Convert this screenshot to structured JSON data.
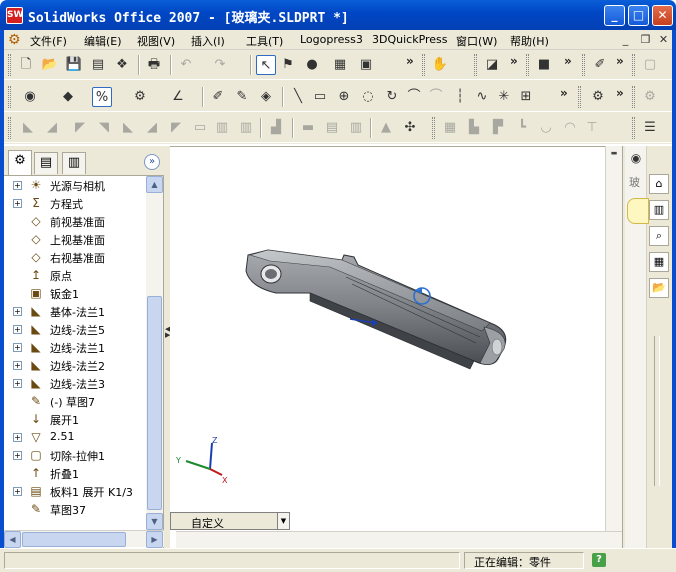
{
  "window": {
    "title": "SolidWorks Office 2007 - [玻璃夹.SLDPRT *]",
    "app_icon": "SW",
    "minimize": "_",
    "maximize": "□",
    "close": "✕"
  },
  "menu": {
    "items": [
      {
        "label": "文件",
        "key": "(F)"
      },
      {
        "label": "编辑",
        "key": "(E)"
      },
      {
        "label": "视图",
        "key": "(V)"
      },
      {
        "label": "插入",
        "key": "(I)"
      },
      {
        "label": "工具",
        "key": "(T)"
      },
      {
        "label": "Logopress3",
        "key": ""
      },
      {
        "label": "3DQuickPress",
        "key": ""
      },
      {
        "label": "窗口",
        "key": "(W)"
      },
      {
        "label": "帮助",
        "key": "(H)"
      }
    ],
    "mdi_minimize": "_",
    "mdi_restore": "❐",
    "mdi_close": "✕"
  },
  "feature_tree": {
    "items": [
      {
        "label": "光源与相机",
        "icon": "lights-cameras-icon",
        "glyph": "☀",
        "expand": "+"
      },
      {
        "label": "方程式",
        "icon": "equations-icon",
        "glyph": "Σ",
        "expand": "+"
      },
      {
        "label": "前视基准面",
        "icon": "plane-icon",
        "glyph": "◇",
        "expand": ""
      },
      {
        "label": "上视基准面",
        "icon": "plane-icon",
        "glyph": "◇",
        "expand": ""
      },
      {
        "label": "右视基准面",
        "icon": "plane-icon",
        "glyph": "◇",
        "expand": ""
      },
      {
        "label": "原点",
        "icon": "origin-icon",
        "glyph": "↥",
        "expand": ""
      },
      {
        "label": "钣金1",
        "icon": "sheetmetal-icon",
        "glyph": "▣",
        "expand": ""
      },
      {
        "label": "基体-法兰1",
        "icon": "base-flange-icon",
        "glyph": "◣",
        "expand": "+"
      },
      {
        "label": "边线-法兰5",
        "icon": "edge-flange-icon",
        "glyph": "◣",
        "expand": "+"
      },
      {
        "label": "边线-法兰1",
        "icon": "edge-flange-icon",
        "glyph": "◣",
        "expand": "+"
      },
      {
        "label": "边线-法兰2",
        "icon": "edge-flange-icon",
        "glyph": "◣",
        "expand": "+"
      },
      {
        "label": "边线-法兰3",
        "icon": "edge-flange-icon",
        "glyph": "◣",
        "expand": "+"
      },
      {
        "label": "(-) 草图7",
        "icon": "sketch-icon",
        "glyph": "✎",
        "expand": ""
      },
      {
        "label": "展开1",
        "icon": "unfold-icon",
        "glyph": "↓",
        "expand": ""
      },
      {
        "label": "2.51",
        "icon": "dimension-icon",
        "glyph": "▽",
        "expand": "+"
      },
      {
        "label": "切除-拉伸1",
        "icon": "cut-extrude-icon",
        "glyph": "▢",
        "expand": "+"
      },
      {
        "label": "折叠1",
        "icon": "fold-icon",
        "glyph": "↑",
        "expand": ""
      },
      {
        "label": "板料1 展开 K1/3",
        "icon": "flat-pattern-icon",
        "glyph": "▤",
        "expand": "+"
      },
      {
        "label": "草图37",
        "icon": "sketch-icon",
        "glyph": "✎",
        "expand": ""
      }
    ]
  },
  "graphics": {
    "triad": {
      "x": "X",
      "y": "Y",
      "z": "Z"
    },
    "config_label": "自定义",
    "accent_color": "#5a5e63"
  },
  "taskpane": {
    "strip_text": "玻"
  },
  "status": {
    "text": "正在编辑：零件",
    "help": "?"
  }
}
